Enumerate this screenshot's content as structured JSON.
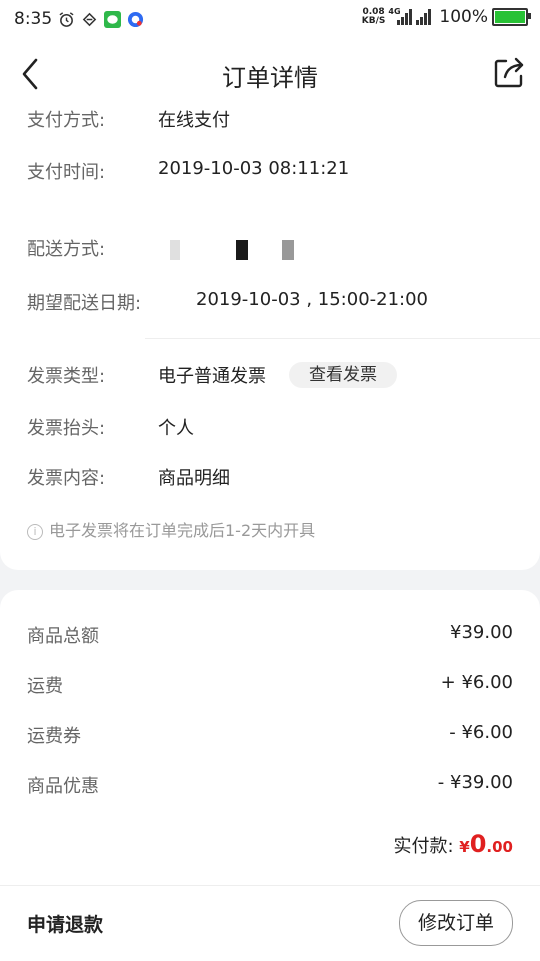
{
  "status_bar": {
    "time": "8:35",
    "net_speed_value": "0.08",
    "net_speed_unit": "KB/S",
    "net_type": "4G",
    "battery_text": "100%",
    "battery_level": 1.0
  },
  "header": {
    "title": "订单详情",
    "back_icon": "chevron-left-icon",
    "share_icon": "share-icon"
  },
  "order_info": {
    "payment_method_label": "支付方式:",
    "payment_method_value": "在线支付",
    "payment_time_label": "支付时间:",
    "payment_time_value": "2019-10-03 08:11:21",
    "delivery_method_label": "配送方式:",
    "expected_date_label": "期望配送日期:",
    "expected_date_value": "2019-10-03 , 15:00-21:00",
    "invoice_type_label": "发票类型:",
    "invoice_type_value": "电子普通发票",
    "view_invoice_button": "查看发票",
    "invoice_title_label": "发票抬头:",
    "invoice_title_value": "个人",
    "invoice_content_label": "发票内容:",
    "invoice_content_value": "商品明细",
    "note": "电子发票将在订单完成后1-2天内开具",
    "note_icon": "info-icon"
  },
  "price_summary": {
    "rows": [
      {
        "label": "商品总额",
        "value": "¥39.00"
      },
      {
        "label": "运费",
        "value": "+ ¥6.00"
      },
      {
        "label": "运费券",
        "value": "- ¥6.00"
      },
      {
        "label": "商品优惠",
        "value": "- ¥39.00"
      }
    ],
    "paid_label": "实付款:",
    "paid_currency": "¥",
    "paid_integer": "0",
    "paid_decimal": ".00",
    "accent_color": "#e02020"
  },
  "footer": {
    "refund_label": "申请退款",
    "modify_label": "修改订单"
  }
}
